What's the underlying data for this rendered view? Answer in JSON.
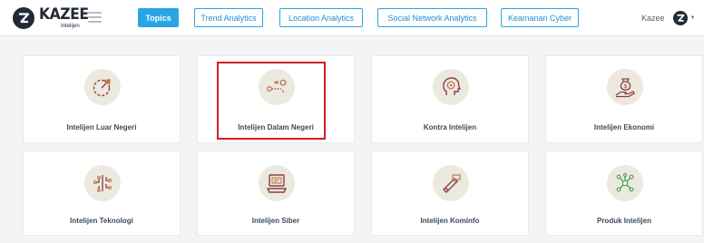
{
  "header": {
    "logo": {
      "word": "KAZEE",
      "sub": "Intelijen"
    },
    "nav": [
      {
        "label": "Topics",
        "active": true
      },
      {
        "label": "Trend Analytics",
        "active": false
      },
      {
        "label": "Location Analytics",
        "active": false
      },
      {
        "label": "Social Network Analytics",
        "active": false
      },
      {
        "label": "Keamanan Cyber",
        "active": false
      }
    ],
    "user": {
      "name": "Kazee"
    }
  },
  "cards": [
    {
      "label": "Intelijen Luar Negeri",
      "icon": "globe-plane-icon"
    },
    {
      "label": "Intelijen Dalam Negeri",
      "icon": "route-map-icon"
    },
    {
      "label": "Kontra Intelijen",
      "icon": "head-target-icon"
    },
    {
      "label": "Intelijen Ekonomi",
      "icon": "money-hand-icon"
    },
    {
      "label": "Intelijen Teknologi",
      "icon": "circuit-icon"
    },
    {
      "label": "Intelijen Siber",
      "icon": "computer-security-icon"
    },
    {
      "label": "Intelijen Kominfo",
      "icon": "megaphone-icon"
    },
    {
      "label": "Produk Intelijen",
      "icon": "network-nodes-icon"
    }
  ],
  "colors": {
    "accent": "#29a4e4",
    "brand_dark": "#222a35",
    "highlight_border": "#d21f1f",
    "icon_circle": "#ece9df",
    "page_bg": "#f3f4f6"
  }
}
